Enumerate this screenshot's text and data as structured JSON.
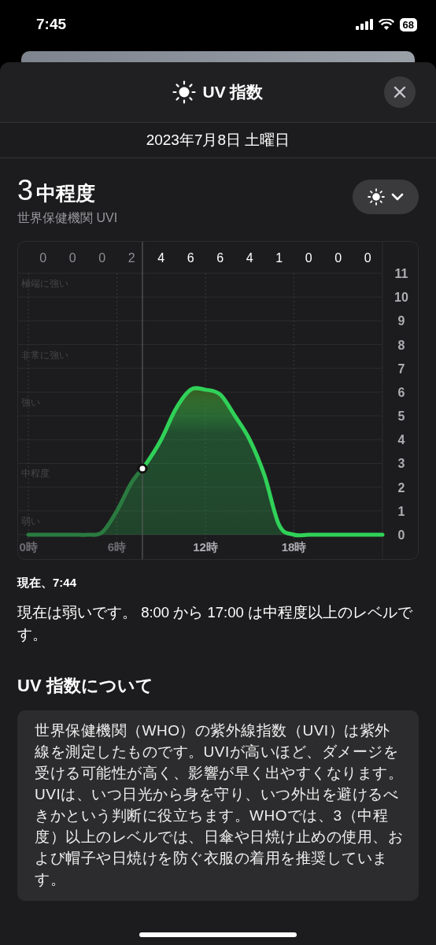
{
  "status_bar": {
    "time": "7:45",
    "battery": "68"
  },
  "sheet": {
    "title": "UV 指数",
    "date": "2023年7月8日 土曜日"
  },
  "current": {
    "index": "3",
    "category": "中程度",
    "source": "世界保健機関 UVI"
  },
  "chart": {
    "hourly_values": [
      {
        "value": "0",
        "past": true
      },
      {
        "value": "0",
        "past": true
      },
      {
        "value": "0",
        "past": true
      },
      {
        "value": "2",
        "past": true
      },
      {
        "value": "4",
        "past": false
      },
      {
        "value": "6",
        "past": false
      },
      {
        "value": "6",
        "past": false
      },
      {
        "value": "4",
        "past": false
      },
      {
        "value": "1",
        "past": false
      },
      {
        "value": "0",
        "past": false
      },
      {
        "value": "0",
        "past": false
      },
      {
        "value": "0",
        "past": false
      }
    ],
    "chart_data": {
      "type": "area",
      "x": [
        0,
        1,
        2,
        3,
        4,
        5,
        6,
        7,
        8,
        9,
        10,
        11,
        12,
        13,
        14,
        15,
        16,
        17,
        18,
        19,
        20,
        21,
        22,
        23,
        24
      ],
      "series": [
        {
          "color": "#30d158",
          "values": [
            0,
            0,
            0,
            0,
            0,
            0.1,
            1.0,
            2.2,
            3.0,
            4.0,
            5.3,
            6.1,
            6.1,
            5.9,
            5.0,
            4.0,
            2.5,
            0.4,
            0,
            0,
            0,
            0,
            0,
            0,
            0
          ]
        }
      ],
      "xlim": [
        -0.75,
        24
      ],
      "ylim": [
        0,
        11
      ],
      "grid": true,
      "xticks": [
        {
          "value": 0,
          "label": "0時"
        },
        {
          "value": 6,
          "label": "6時"
        },
        {
          "value": 12,
          "label": "12時"
        },
        {
          "value": 18,
          "label": "18時"
        }
      ],
      "yticks": [
        0,
        1,
        2,
        3,
        4,
        5,
        6,
        7,
        8,
        9,
        10,
        11
      ],
      "annotations": [
        "極端に強い",
        "非常に強い",
        "強い",
        "中程度",
        "弱い"
      ],
      "ref_lines": [
        {
          "axis": "x",
          "value": 7.73
        }
      ]
    }
  },
  "now_label": "現在、7:44",
  "summary": "現在は弱いです。 8:00 から 17:00 は中程度以上のレベルです。",
  "about": {
    "heading": "UV 指数について",
    "body": "世界保健機関（WHO）の紫外線指数（UVI）は紫外線を測定したものです。UVIが高いほど、ダメージを受ける可能性が高く、影響が早く出やすくなります。UVIは、いつ日光から身を守り、いつ外出を避けるべきかという判断に役立ちます。WHOでは、3（中程度）以上のレベルでは、日傘や日焼け止めの使用、および帽子や日焼けを防ぐ衣服の着用を推奨しています。"
  }
}
